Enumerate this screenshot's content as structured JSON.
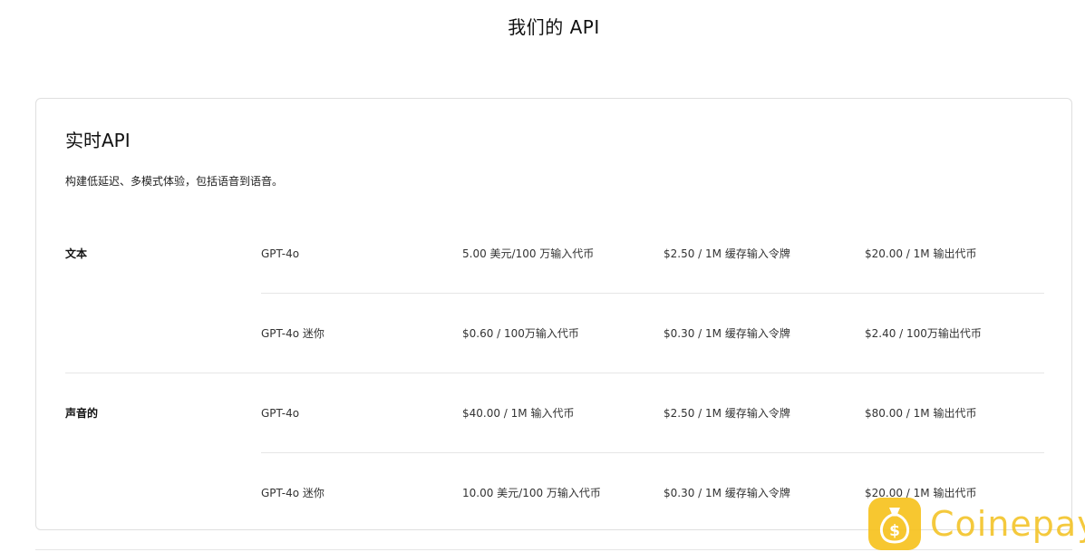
{
  "page": {
    "title": "我们的 API"
  },
  "card": {
    "title": "实时API",
    "description": "构建低延迟、多模式体验，包括语音到语音。"
  },
  "groups": [
    {
      "label": "文本",
      "rows": [
        {
          "model": "GPT-4o",
          "input": "5.00 美元/100 万输入代币",
          "cached": "$2.50 / 1M 缓存输入令牌",
          "output": "$20.00 / 1M 输出代币"
        },
        {
          "model": "GPT-4o 迷你",
          "input": "$0.60 / 100万输入代币",
          "cached": "$0.30 / 1M 缓存输入令牌",
          "output": "$2.40 / 100万输出代币"
        }
      ]
    },
    {
      "label": "声音的",
      "rows": [
        {
          "model": "GPT-4o",
          "input": "$40.00 / 1M 输入代币",
          "cached": "$2.50 / 1M 缓存输入令牌",
          "output": "$80.00 / 1M 输出代币"
        },
        {
          "model": "GPT-4o 迷你",
          "input": "10.00 美元/100 万输入代币",
          "cached": "$0.30 / 1M 缓存输入令牌",
          "output": "$20.00 / 1M 输出代币"
        }
      ]
    }
  ],
  "watermark": {
    "text": "Coinepay",
    "icon": "money-bag-icon",
    "color": "#f7c21a"
  }
}
